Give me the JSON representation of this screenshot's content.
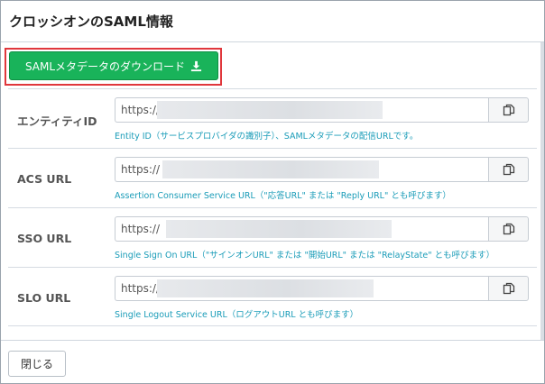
{
  "modal": {
    "title": "クロッシオンのSAML情報",
    "download_label": "SAMLメタデータのダウンロード",
    "close_label": "閉じる"
  },
  "fields": [
    {
      "label": "エンティティID",
      "value": "https://",
      "help": "Entity ID（サービスプロバイダの識別子）、SAMLメタデータの配信URLです。"
    },
    {
      "label": "ACS URL",
      "value": "https://",
      "help": "Assertion Consumer Service URL（\"応答URL\" または \"Reply URL\" とも呼びます）"
    },
    {
      "label": "SSO URL",
      "value": "https://",
      "help": "Single Sign On URL（\"サインオンURL\" または \"開始URL\" または \"RelayState\" とも呼びます）"
    },
    {
      "label": "SLO URL",
      "value": "https://",
      "help": "Single Logout Service URL（ログアウトURL とも呼びます）"
    }
  ],
  "icons": {
    "download": "download-icon",
    "copy": "copy-icon"
  },
  "colors": {
    "primary_button": "#19b35a",
    "highlight_border": "#e0373c",
    "help_text": "#1a9cb8"
  }
}
